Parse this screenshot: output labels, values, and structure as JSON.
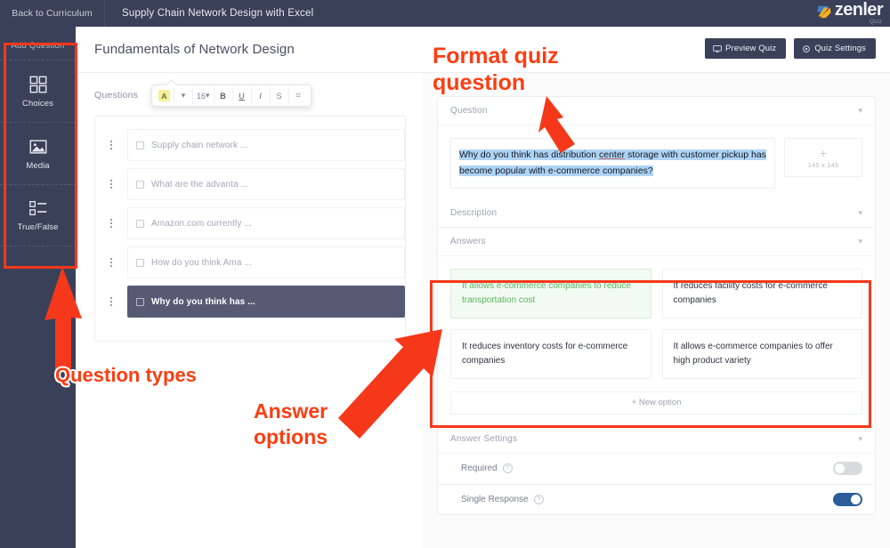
{
  "topbar": {
    "back_label": "Back to Curriculum",
    "course_title": "Supply Chain Network Design with Excel",
    "logo_word": "zenler",
    "logo_sub": "Quiz"
  },
  "rail": {
    "title": "Add Question",
    "items": [
      {
        "label": "Choices",
        "icon": "grid-squares-icon"
      },
      {
        "label": "Media",
        "icon": "image-icon"
      },
      {
        "label": "True/False",
        "icon": "checkbox-list-icon"
      }
    ]
  },
  "panel": {
    "title": "Fundamentals of Network Design",
    "preview_label": "Preview Quiz",
    "settings_label": "Quiz Settings"
  },
  "questions": {
    "label": "Questions",
    "items": [
      {
        "text": "Supply chain network ...",
        "active": false
      },
      {
        "text": "What are the advanta ...",
        "active": false
      },
      {
        "text": "Amazon.com currently ...",
        "active": false
      },
      {
        "text": "How do you think Ama ...",
        "active": false
      },
      {
        "text": "Why do you think has ...",
        "active": true
      }
    ]
  },
  "editor": {
    "sections": {
      "question": "Question",
      "description": "Description",
      "answers": "Answers",
      "answer_settings": "Answer Settings"
    },
    "question_text_part1": "Why do you think has distribution ",
    "question_text_underlined": "center",
    "question_text_part2": " storage with customer pickup has become popular with e-commerce companies?",
    "image_placeholder": {
      "plus": "+",
      "dims": "145 x 145"
    },
    "format_toolbar": {
      "text_color": "A",
      "color_caret": "▾",
      "font_size": "16",
      "size_caret": "▾",
      "bold": "B",
      "underline": "U",
      "italic": "I",
      "strike": "S",
      "link": "⌗"
    },
    "answers": [
      {
        "text": "It allows e-commerce companies to reduce transportation cost",
        "correct": true
      },
      {
        "text": "It reduces facility costs for e-commerce companies",
        "correct": false
      },
      {
        "text": "It reduces inventory costs for e-commerce companies",
        "correct": false
      },
      {
        "text": "It allows e-commerce companies to offer high product variety",
        "correct": false
      }
    ],
    "new_option_label": "+ New option",
    "settings": [
      {
        "label": "Required",
        "hint": "?",
        "on": false
      },
      {
        "label": "Single Response",
        "hint": "?",
        "on": true
      }
    ]
  },
  "annotations": [
    {
      "id": "format-quiz-question",
      "line1": "Format quiz",
      "line2": "question"
    },
    {
      "id": "question-types",
      "line1": "Question types",
      "line2": ""
    },
    {
      "id": "answer-options",
      "line1": "Answer",
      "line2": "options"
    }
  ],
  "colors": {
    "dark_navy": "#3b4059",
    "annotation_red": "#fc3d12",
    "correct_green": "#59b45e",
    "selection_blue": "#aed4f5",
    "toggle_on_blue": "#2b5d9b"
  }
}
